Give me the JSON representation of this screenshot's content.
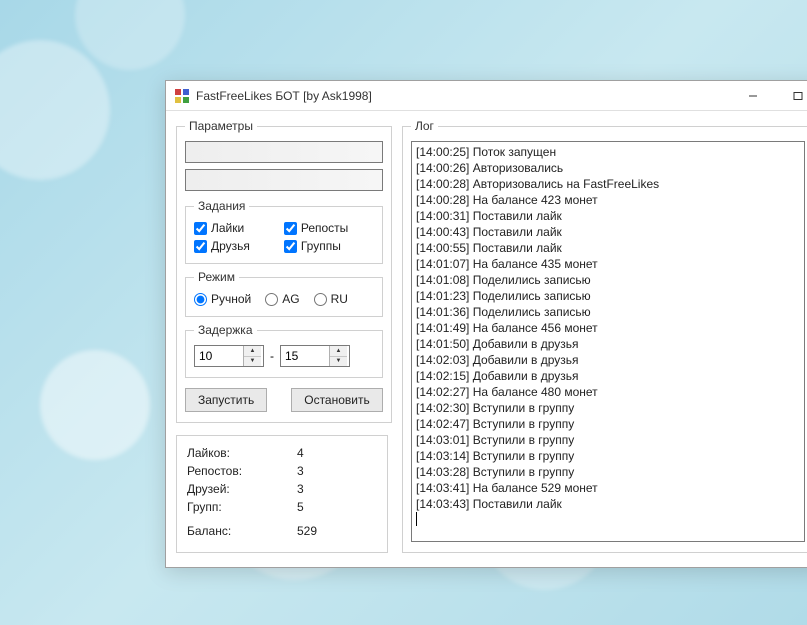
{
  "window": {
    "title": "FastFreeLikes БОТ [by Ask1998]"
  },
  "params": {
    "legend": "Параметры",
    "input1": "",
    "input2": "",
    "tasks": {
      "legend": "Задания",
      "likes": "Лайки",
      "reposts": "Репосты",
      "friends": "Друзья",
      "groups": "Группы"
    },
    "mode": {
      "legend": "Режим",
      "manual": "Ручной",
      "ag": "AG",
      "ru": "RU"
    },
    "delay": {
      "legend": "Задержка",
      "from": "10",
      "sep": "-",
      "to": "15"
    },
    "buttons": {
      "start": "Запустить",
      "stop": "Остановить"
    }
  },
  "stats": {
    "rows": [
      {
        "label": "Лайков:",
        "value": "4"
      },
      {
        "label": "Репостов:",
        "value": "3"
      },
      {
        "label": "Друзей:",
        "value": "3"
      },
      {
        "label": "Групп:",
        "value": "5"
      },
      {
        "label": "Баланс:",
        "value": "529"
      }
    ]
  },
  "log": {
    "legend": "Лог",
    "lines": [
      "[14:00:25] Поток запущен",
      "[14:00:26] Авторизовались",
      "[14:00:28] Авторизовались на FastFreeLikes",
      "[14:00:28] На балансе 423 монет",
      "[14:00:31] Поставили лайк",
      "[14:00:43] Поставили лайк",
      "[14:00:55] Поставили лайк",
      "[14:01:07] На балансе 435 монет",
      "[14:01:08] Поделились записью",
      "[14:01:23] Поделились записью",
      "[14:01:36] Поделились записью",
      "[14:01:49] На балансе 456 монет",
      "[14:01:50] Добавили в друзья",
      "[14:02:03] Добавили в друзья",
      "[14:02:15] Добавили в друзья",
      "[14:02:27] На балансе 480 монет",
      "[14:02:30] Вступили в группу",
      "[14:02:47] Вступили в группу",
      "[14:03:01] Вступили в группу",
      "[14:03:14] Вступили в группу",
      "[14:03:28] Вступили в группу",
      "[14:03:41] На балансе 529 монет",
      "[14:03:43] Поставили лайк"
    ]
  }
}
